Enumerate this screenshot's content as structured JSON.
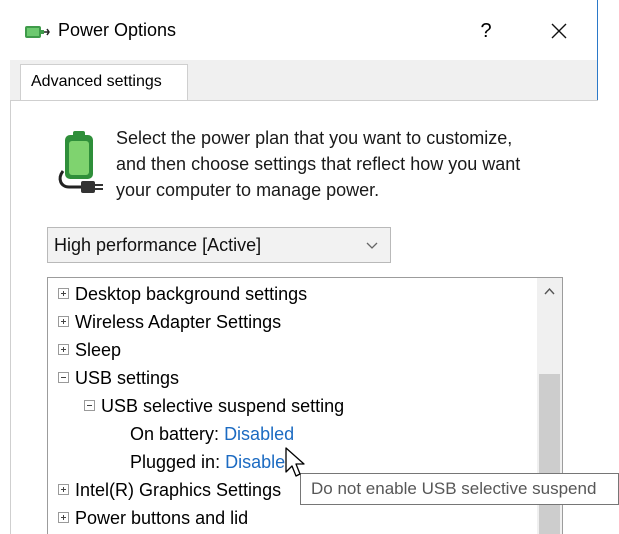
{
  "window": {
    "title": "Power Options",
    "help_label": "?",
    "close_icon": "close-icon",
    "app_icon": "power-options-icon",
    "accent_color": "#2b79c9"
  },
  "tabs": [
    {
      "label": "Advanced settings",
      "selected": true
    }
  ],
  "intro": {
    "lines": [
      "Select the power plan that you want to customize,",
      "and then choose settings that reflect how you want",
      "your computer to manage power."
    ],
    "icon": "battery-plug-icon"
  },
  "plan_select": {
    "value": "High performance [Active]",
    "icon": "chevron-down-icon"
  },
  "settings_tree": {
    "items": [
      {
        "label": "Desktop background settings",
        "state": "collapsed"
      },
      {
        "label": "Wireless Adapter Settings",
        "state": "collapsed"
      },
      {
        "label": "Sleep",
        "state": "collapsed"
      },
      {
        "label": "USB settings",
        "state": "expanded"
      },
      {
        "label": "USB selective suspend setting",
        "state": "expanded"
      },
      {
        "label": "On battery:",
        "value": "Disabled"
      },
      {
        "label": "Plugged in:",
        "value": "Disabled"
      },
      {
        "label": "Intel(R) Graphics Settings",
        "state": "collapsed"
      },
      {
        "label": "Power buttons and lid",
        "state": "collapsed"
      }
    ],
    "link_color": "#1c6bc2"
  },
  "tooltip": {
    "text": "Do not enable USB selective suspend"
  }
}
